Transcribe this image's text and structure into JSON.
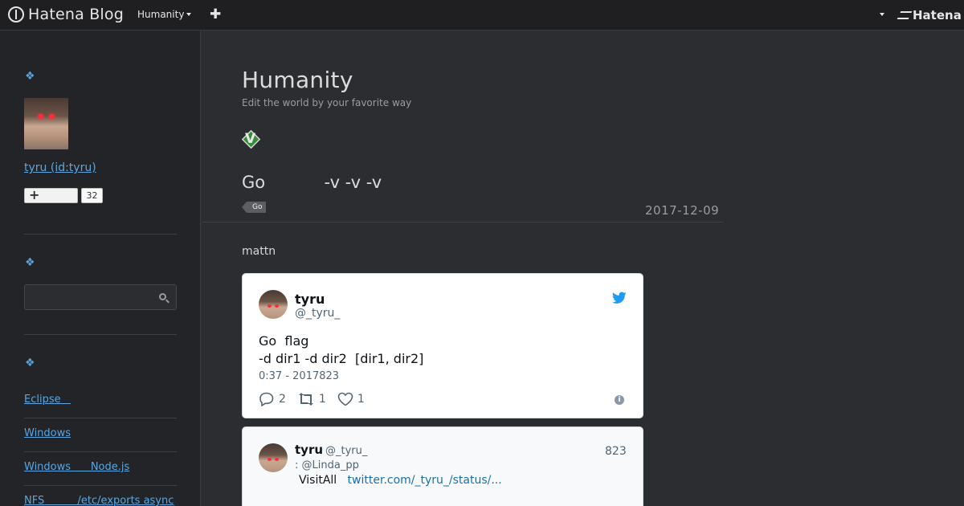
{
  "topbar": {
    "logo_text": "Hatena Blog",
    "blog_menu": "Humanity",
    "hatena_text": "Hatena"
  },
  "sidebar": {
    "user_link": "tyru (id:tyru)",
    "follow_count": "32",
    "links": [
      "Eclipse   ",
      "Windows",
      "Windows      Node.js",
      "NFS          /etc/exports async"
    ]
  },
  "main": {
    "blog_title": "Humanity",
    "blog_description": "Edit the world by your favorite way",
    "entry_title": "Go           -v -v -v",
    "category": "Go",
    "date": "2017-12-09",
    "body_text": "mattn"
  },
  "tweet": {
    "name": "tyru",
    "handle": "@_tyru_",
    "text_line1": "Go  flag",
    "text_line2": "-d dir1 -d dir2  [dir1, dir2]",
    "time": "0:37 - 2017823",
    "replies": "2",
    "retweets": "1",
    "likes": "1",
    "info": "i"
  },
  "reply": {
    "name": "tyru",
    "handle": "@_tyru_",
    "date": "823",
    "reply_to": ": @Linda_pp",
    "text_prefix": "VisitAll   ",
    "link": "twitter.com/_tyru_/status/..."
  },
  "colors": {
    "accent_link": "#5aa6e0",
    "twitter_blue": "#1d9bf0",
    "background": "#2b2d30"
  }
}
